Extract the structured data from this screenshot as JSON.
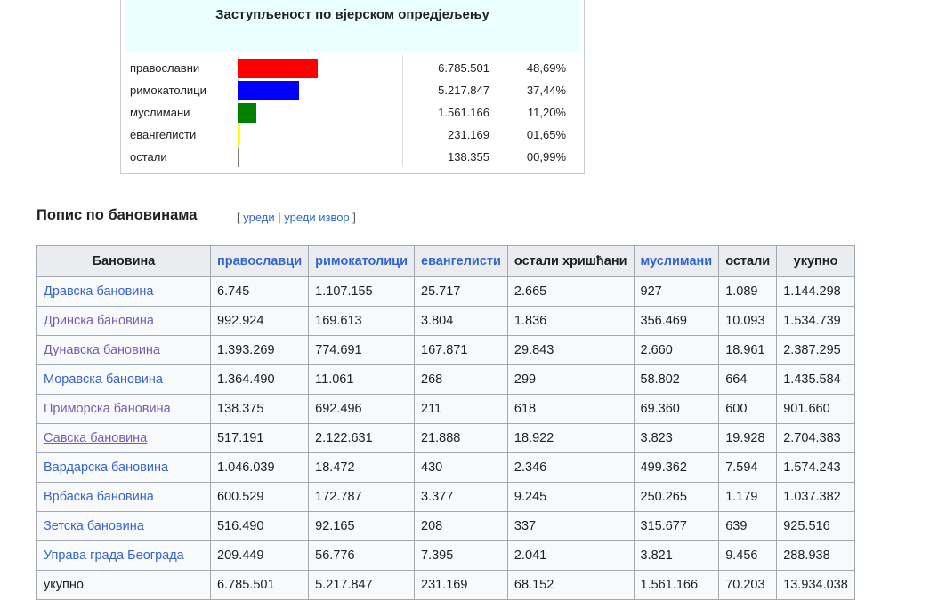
{
  "religion_box": {
    "title": "Заступљеност по вјерском опредјељењу",
    "rows": [
      {
        "name": "православни",
        "count": "6.785.501",
        "pct": "48,69%",
        "share": 48.69,
        "color": "#ff0000"
      },
      {
        "name": "римокатолици",
        "count": "5.217.847",
        "pct": "37,44%",
        "share": 37.44,
        "color": "#0000ff"
      },
      {
        "name": "муслимани",
        "count": "1.561.166",
        "pct": "11,20%",
        "share": 11.2,
        "color": "#008000"
      },
      {
        "name": "евангелисти",
        "count": "231.169",
        "pct": "01,65%",
        "share": 1.65,
        "color": "#ffff00"
      },
      {
        "name": "остали",
        "count": "138.355",
        "pct": "00,99%",
        "share": 0.99,
        "color": "#808080"
      }
    ]
  },
  "section": {
    "title": "Попис по бановинама",
    "edit_open": "[ ",
    "edit_label": "уреди",
    "edit_sep": " | ",
    "edit_source_label": "уреди извор",
    "edit_close": " ]"
  },
  "table": {
    "headers": [
      "Бановина",
      "православци",
      "римокатолици",
      "евангелисти",
      "остали хришћани",
      "муслимани",
      "остали",
      "укупно"
    ],
    "rows": [
      {
        "name": "Дравска бановина",
        "style": "link",
        "values": [
          "6.745",
          "1.107.155",
          "25.717",
          "2.665",
          "927",
          "1.089",
          "1.144.298"
        ]
      },
      {
        "name": "Дринска бановина",
        "style": "visited",
        "values": [
          "992.924",
          "169.613",
          "3.804",
          "1.836",
          "356.469",
          "10.093",
          "1.534.739"
        ]
      },
      {
        "name": "Дунавска бановина",
        "style": "visited",
        "values": [
          "1.393.269",
          "774.691",
          "167.871",
          "29.843",
          "2.660",
          "18.961",
          "2.387.295"
        ]
      },
      {
        "name": "Моравска бановина",
        "style": "link",
        "values": [
          "1.364.490",
          "11.061",
          "268",
          "299",
          "58.802",
          "664",
          "1.435.584"
        ]
      },
      {
        "name": "Приморска бановина",
        "style": "visited",
        "values": [
          "138.375",
          "692.496",
          "211",
          "618",
          "69.360",
          "600",
          "901.660"
        ]
      },
      {
        "name": "Савска бановина",
        "style": "visited-underline",
        "values": [
          "517.191",
          "2.122.631",
          "21.888",
          "18.922",
          "3.823",
          "19.928",
          "2.704.383"
        ]
      },
      {
        "name": "Вардарска бановина",
        "style": "link",
        "values": [
          "1.046.039",
          "18.472",
          "430",
          "2.346",
          "499.362",
          "7.594",
          "1.574.243"
        ]
      },
      {
        "name": "Врбаска бановина",
        "style": "link",
        "values": [
          "600.529",
          "172.787",
          "3.377",
          "9.245",
          "250.265",
          "1.179",
          "1.037.382"
        ]
      },
      {
        "name": "Зетска бановина",
        "style": "link",
        "values": [
          "516.490",
          "92.165",
          "208",
          "337",
          "315.677",
          "639",
          "925.516"
        ]
      },
      {
        "name": "Управа града Београда",
        "style": "link",
        "values": [
          "209.449",
          "56.776",
          "7.395",
          "2.041",
          "3.821",
          "9.456",
          "288.938"
        ]
      },
      {
        "name": "укупно",
        "style": "plain",
        "values": [
          "6.785.501",
          "5.217.847",
          "231.169",
          "68.152",
          "1.561.166",
          "70.203",
          "13.934.038"
        ]
      }
    ]
  }
}
